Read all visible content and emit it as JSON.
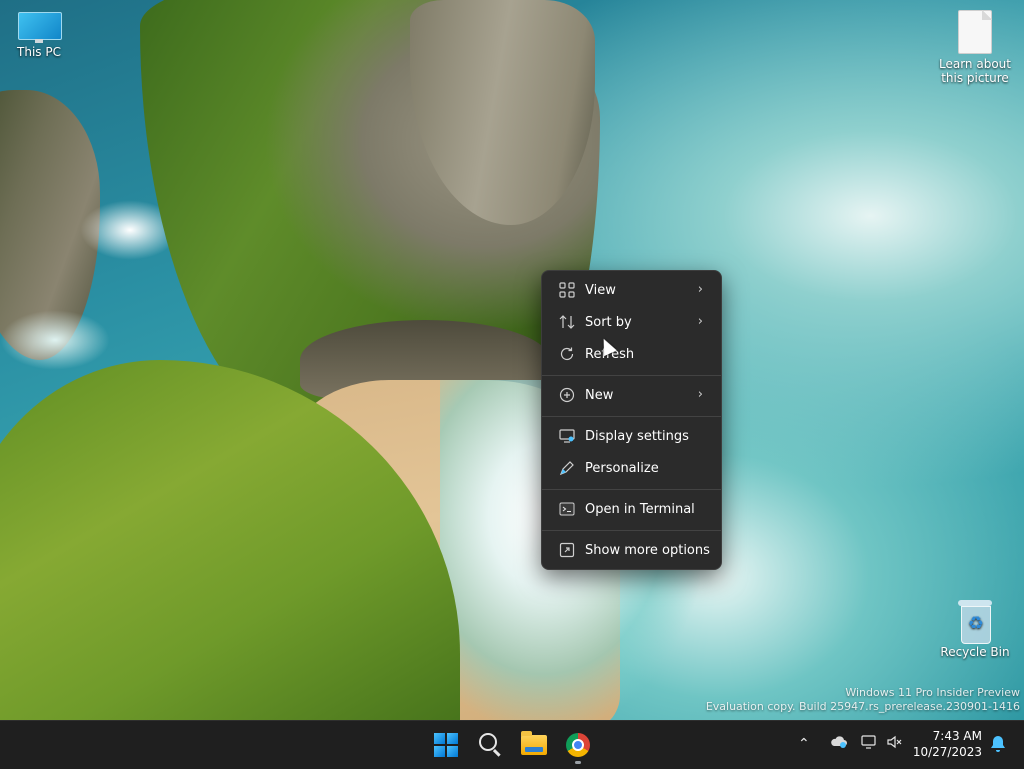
{
  "desktop": {
    "icons": [
      {
        "label": "This PC"
      },
      {
        "label": "Learn about this picture"
      },
      {
        "label": "Recycle Bin"
      }
    ],
    "watermark": {
      "line1": "Windows 11 Pro Insider Preview",
      "line2": "Evaluation copy. Build 25947.rs_prerelease.230901-1416"
    }
  },
  "context_menu": {
    "items": [
      {
        "label": "View",
        "icon": "view-grid-icon",
        "submenu": true
      },
      {
        "label": "Sort by",
        "icon": "sort-icon",
        "submenu": true
      },
      {
        "label": "Refresh",
        "icon": "refresh-icon",
        "submenu": false
      },
      {
        "label": "New",
        "icon": "new-plus-icon",
        "submenu": true
      },
      {
        "label": "Display settings",
        "icon": "display-settings-icon",
        "submenu": false
      },
      {
        "label": "Personalize",
        "icon": "pen-icon",
        "submenu": false
      },
      {
        "label": "Open in Terminal",
        "icon": "terminal-icon",
        "submenu": false
      },
      {
        "label": "Show more options",
        "icon": "expand-icon",
        "submenu": false
      }
    ]
  },
  "taskbar": {
    "apps": [
      "start-icon",
      "search-icon",
      "file-explorer-icon",
      "chrome-icon"
    ],
    "clock": {
      "time": "7:43 AM",
      "date": "10/27/2023"
    }
  },
  "colors": {
    "menu_bg": "#2b2b2b",
    "taskbar_bg": "#1f1f1f",
    "accent": "#4cc2ff"
  }
}
